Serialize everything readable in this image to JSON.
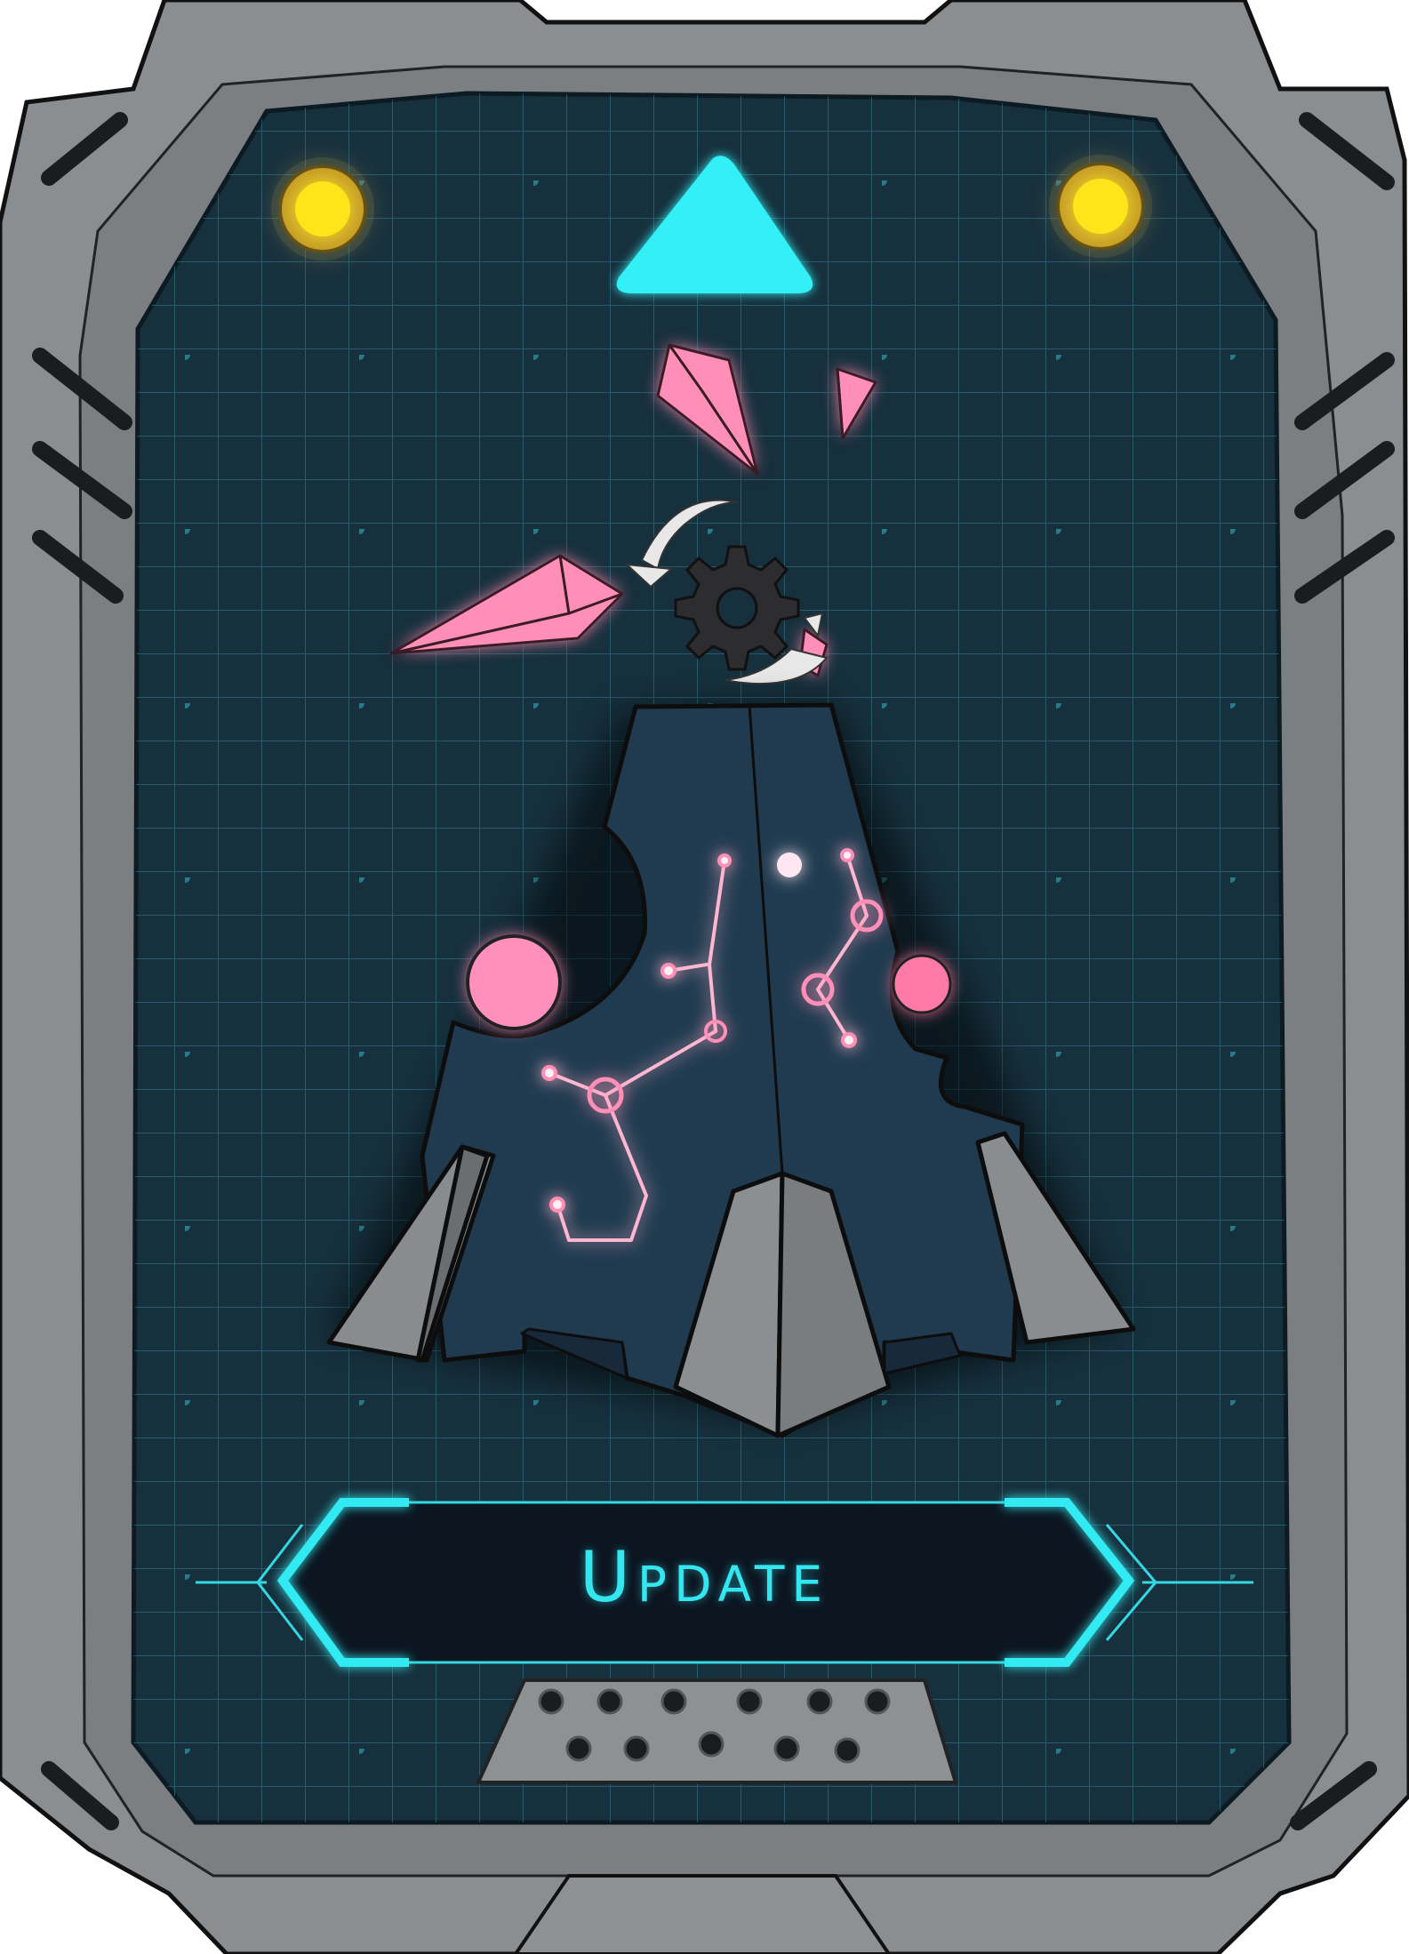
{
  "card": {
    "action_label": "Update",
    "colors": {
      "frame": "#8a8d90",
      "frame_dark": "#6d7174",
      "screen": "#15303e",
      "grid": "#2a6a7a",
      "accent_cyan": "#33e6f0",
      "crystal_pink": "#ff8fb8",
      "tower": "#203b4e",
      "lamp_yellow": "#ffe31a"
    },
    "icons": {
      "top": "up-arrow-triangle",
      "center": "gear-icon",
      "rotate": "refresh-arrows-icon"
    }
  }
}
